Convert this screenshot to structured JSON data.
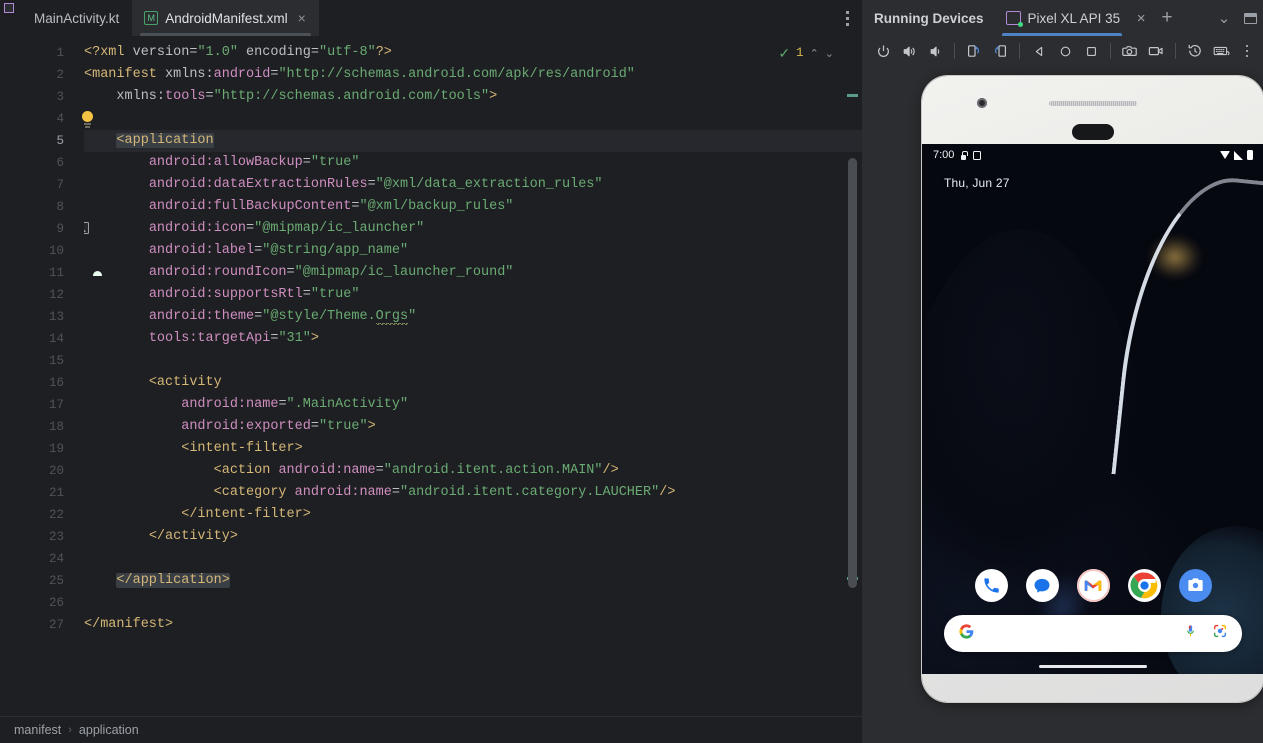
{
  "editor": {
    "tabs": [
      {
        "label": "MainActivity.kt",
        "icon": "kotlin-file-icon",
        "active": false,
        "closable": false
      },
      {
        "label": "AndroidManifest.xml",
        "icon": "xml-file-icon",
        "active": true,
        "closable": true
      }
    ],
    "tab_close_glyph": "×",
    "options_menu": "more-options",
    "inspection": {
      "status_glyph": "✓",
      "warning_count": "1",
      "prev_glyph": "⌃",
      "next_glyph": "⌄"
    },
    "breadcrumb": {
      "items": [
        "manifest",
        "application"
      ],
      "separator": "›"
    },
    "gutter_markers": [
      {
        "line": 4,
        "icon": "lightbulb-icon"
      },
      {
        "line": 9,
        "icon": "image-resource-icon"
      },
      {
        "line": 11,
        "icon": "android-launcher-icon"
      }
    ],
    "current_line": 5,
    "code_lines": [
      {
        "n": 1,
        "tokens": [
          {
            "t": "tag",
            "v": "<?xml "
          },
          {
            "t": "attr",
            "v": "version"
          },
          {
            "t": "eq",
            "v": "="
          },
          {
            "t": "str",
            "v": "\"1.0\""
          },
          {
            "t": "attr",
            "v": " encoding"
          },
          {
            "t": "eq",
            "v": "="
          },
          {
            "t": "str",
            "v": "\"utf-8\""
          },
          {
            "t": "tag",
            "v": "?>"
          }
        ]
      },
      {
        "n": 2,
        "tokens": [
          {
            "t": "tag",
            "v": "<manifest "
          },
          {
            "t": "attr",
            "v": "xmlns:"
          },
          {
            "t": "ns",
            "v": "android"
          },
          {
            "t": "eq",
            "v": "="
          },
          {
            "t": "str",
            "v": "\"http://schemas.android.com/apk/res/android\""
          }
        ]
      },
      {
        "n": 3,
        "indent": 4,
        "tokens": [
          {
            "t": "attr",
            "v": "xmlns:"
          },
          {
            "t": "ns",
            "v": "tools"
          },
          {
            "t": "eq",
            "v": "="
          },
          {
            "t": "str",
            "v": "\"http://schemas.android.com/tools\""
          },
          {
            "t": "tag",
            "v": ">"
          }
        ]
      },
      {
        "n": 4,
        "tokens": []
      },
      {
        "n": 5,
        "indent": 4,
        "highlight": true,
        "tokens": [
          {
            "t": "tag",
            "v": "<application",
            "hl": true
          }
        ]
      },
      {
        "n": 6,
        "indent": 8,
        "tokens": [
          {
            "t": "ns",
            "v": "android:allowBackup"
          },
          {
            "t": "eq",
            "v": "="
          },
          {
            "t": "str",
            "v": "\"true\""
          }
        ]
      },
      {
        "n": 7,
        "indent": 8,
        "tokens": [
          {
            "t": "ns",
            "v": "android:dataExtractionRules"
          },
          {
            "t": "eq",
            "v": "="
          },
          {
            "t": "str",
            "v": "\"@xml/data_extraction_rules\""
          }
        ]
      },
      {
        "n": 8,
        "indent": 8,
        "tokens": [
          {
            "t": "ns",
            "v": "android:fullBackupContent"
          },
          {
            "t": "eq",
            "v": "="
          },
          {
            "t": "str",
            "v": "\"@xml/backup_rules\""
          }
        ]
      },
      {
        "n": 9,
        "indent": 8,
        "tokens": [
          {
            "t": "ns",
            "v": "android:icon"
          },
          {
            "t": "eq",
            "v": "="
          },
          {
            "t": "str",
            "v": "\"@mipmap/ic_launcher\""
          }
        ]
      },
      {
        "n": 10,
        "indent": 8,
        "tokens": [
          {
            "t": "ns",
            "v": "android:label"
          },
          {
            "t": "eq",
            "v": "="
          },
          {
            "t": "str",
            "v": "\"@string/app_name\""
          }
        ]
      },
      {
        "n": 11,
        "indent": 8,
        "tokens": [
          {
            "t": "ns",
            "v": "android:roundIcon"
          },
          {
            "t": "eq",
            "v": "="
          },
          {
            "t": "str",
            "v": "\"@mipmap/ic_launcher_round\""
          }
        ]
      },
      {
        "n": 12,
        "indent": 8,
        "tokens": [
          {
            "t": "ns",
            "v": "android:supportsRtl"
          },
          {
            "t": "eq",
            "v": "="
          },
          {
            "t": "str",
            "v": "\"true\""
          }
        ]
      },
      {
        "n": 13,
        "indent": 8,
        "tokens": [
          {
            "t": "ns",
            "v": "android:theme"
          },
          {
            "t": "eq",
            "v": "="
          },
          {
            "t": "str",
            "v": "\"@style/Theme."
          },
          {
            "t": "str",
            "v": "Orgs",
            "squiggle": true
          },
          {
            "t": "str",
            "v": "\""
          }
        ]
      },
      {
        "n": 14,
        "indent": 8,
        "tokens": [
          {
            "t": "ns",
            "v": "tools:targetApi"
          },
          {
            "t": "eq",
            "v": "="
          },
          {
            "t": "str",
            "v": "\"31\""
          },
          {
            "t": "tag",
            "v": ">"
          }
        ]
      },
      {
        "n": 15,
        "tokens": []
      },
      {
        "n": 16,
        "indent": 8,
        "tokens": [
          {
            "t": "tag",
            "v": "<activity"
          }
        ]
      },
      {
        "n": 17,
        "indent": 12,
        "tokens": [
          {
            "t": "ns",
            "v": "android:name"
          },
          {
            "t": "eq",
            "v": "="
          },
          {
            "t": "str",
            "v": "\".MainActivity\""
          }
        ]
      },
      {
        "n": 18,
        "indent": 12,
        "tokens": [
          {
            "t": "ns",
            "v": "android:exported"
          },
          {
            "t": "eq",
            "v": "="
          },
          {
            "t": "str",
            "v": "\"true\""
          },
          {
            "t": "tag",
            "v": ">"
          }
        ]
      },
      {
        "n": 19,
        "indent": 12,
        "tokens": [
          {
            "t": "tag",
            "v": "<intent-filter>"
          }
        ]
      },
      {
        "n": 20,
        "indent": 16,
        "tokens": [
          {
            "t": "tag",
            "v": "<action "
          },
          {
            "t": "ns",
            "v": "android:name"
          },
          {
            "t": "eq",
            "v": "="
          },
          {
            "t": "str",
            "v": "\"android.itent.action.MAIN\""
          },
          {
            "t": "tag",
            "v": "/>"
          }
        ]
      },
      {
        "n": 21,
        "indent": 16,
        "tokens": [
          {
            "t": "tag",
            "v": "<category "
          },
          {
            "t": "ns",
            "v": "android:name"
          },
          {
            "t": "eq",
            "v": "="
          },
          {
            "t": "str",
            "v": "\"android.itent.category.LAUCHER\""
          },
          {
            "t": "tag",
            "v": "/>"
          }
        ]
      },
      {
        "n": 22,
        "indent": 12,
        "tokens": [
          {
            "t": "tag",
            "v": "</intent-filter>"
          }
        ]
      },
      {
        "n": 23,
        "indent": 8,
        "tokens": [
          {
            "t": "tag",
            "v": "</activity>"
          }
        ]
      },
      {
        "n": 24,
        "tokens": []
      },
      {
        "n": 25,
        "indent": 4,
        "tokens": [
          {
            "t": "tag",
            "v": "</application>",
            "hl": true
          }
        ]
      },
      {
        "n": 26,
        "tokens": []
      },
      {
        "n": 27,
        "tokens": [
          {
            "t": "tag",
            "v": "</manifest>"
          }
        ]
      }
    ]
  },
  "device_panel": {
    "title": "Running Devices",
    "tab": {
      "label": "Pixel XL API 35",
      "icon": "device-icon",
      "close_glyph": "×"
    },
    "add_glyph": "+",
    "collapse_glyph": "⌄",
    "window_icon": "minimize-window-icon",
    "toolbar": [
      {
        "name": "power-button",
        "icon": "power-icon"
      },
      {
        "name": "volume-up-button",
        "icon": "volume-up-icon"
      },
      {
        "name": "volume-down-button",
        "icon": "volume-down-icon"
      },
      {
        "name": "rotate-left-button",
        "icon": "rotate-left-icon"
      },
      {
        "name": "rotate-right-button",
        "icon": "rotate-right-icon"
      },
      {
        "name": "back-button",
        "icon": "back-triangle-icon"
      },
      {
        "name": "home-button",
        "icon": "home-circle-icon"
      },
      {
        "name": "overview-button",
        "icon": "overview-square-icon"
      },
      {
        "name": "screenshot-button",
        "icon": "camera-icon"
      },
      {
        "name": "screen-record-button",
        "icon": "video-camera-icon"
      },
      {
        "name": "rotate-history-button",
        "icon": "history-icon"
      },
      {
        "name": "keyboard-shortcuts-button",
        "icon": "keyboard-icon"
      },
      {
        "name": "more-options-button",
        "icon": "kebab-icon"
      }
    ]
  },
  "phone": {
    "status_bar": {
      "time": "7:00",
      "left_icons": [
        "lock-icon",
        "square-icon"
      ],
      "right_icons": [
        "wifi-icon",
        "signal-icon",
        "battery-icon"
      ]
    },
    "date": "Thu, Jun 27",
    "dock_apps": [
      {
        "name": "phone-app-icon",
        "label": "Phone"
      },
      {
        "name": "messages-app-icon",
        "label": "Messages"
      },
      {
        "name": "gmail-app-icon",
        "label": "Gmail"
      },
      {
        "name": "chrome-app-icon",
        "label": "Chrome"
      },
      {
        "name": "camera-app-icon",
        "label": "Camera"
      }
    ],
    "search_bar": {
      "logo": "google-g-icon",
      "mic": "microphone-icon",
      "lens": "google-lens-icon",
      "placeholder": ""
    },
    "home_indicator": "home-gesture-bar"
  },
  "colors": {
    "editor_bg": "#1e1f22",
    "panel_bg": "#2b2d30",
    "tag": "#d5b778",
    "string": "#6aab73",
    "namespace": "#cf8ec0",
    "attribute": "#bcbec4",
    "accent_blue": "#4f83c8",
    "android_green": "#3ddc84"
  }
}
